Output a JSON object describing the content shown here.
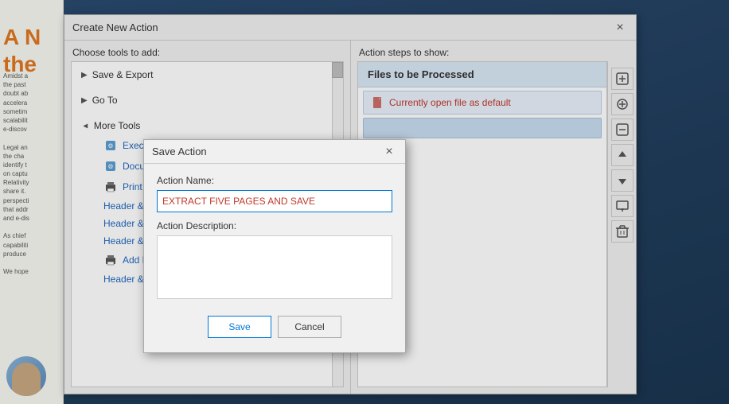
{
  "background": {
    "orange_title": "A N",
    "orange_title2": "the",
    "body_lines": [
      "Amidst a",
      "the past",
      "doubt ab",
      "accelera",
      "sometim",
      "scalabilit",
      "e-discov",
      "",
      "Legal an",
      "the cha",
      "identify t",
      "on captu",
      "Relativity",
      "share it.",
      "perspecti",
      "that addr",
      "and e-dis",
      "",
      "As chief",
      "capabiliti",
      "produce",
      "",
      "We hope"
    ]
  },
  "main_dialog": {
    "title": "Create New Action",
    "close_label": "×",
    "left_panel_label": "Choose tools to add:",
    "right_panel_label": "Action steps to show:",
    "tools": [
      {
        "id": "save-export",
        "label": "Save & Export",
        "type": "group",
        "arrow": "▶",
        "expanded": false
      },
      {
        "id": "go-to",
        "label": "Go To",
        "type": "group",
        "arrow": "▶",
        "expanded": false
      },
      {
        "id": "more-tools",
        "label": "More Tools",
        "type": "group",
        "arrow": "▼",
        "expanded": true
      }
    ],
    "more_tools_items": [
      {
        "id": "execute-js",
        "label": "Execute JavaScript",
        "icon": "⚙"
      },
      {
        "id": "document-js",
        "label": "DocumentJavaScripts",
        "icon": "⚙"
      },
      {
        "id": "print",
        "label": "Print",
        "icon": "🖨"
      },
      {
        "id": "header-footer-1",
        "label": "Header & Footer (Add..."
      },
      {
        "id": "header-footer-2",
        "label": "Header & Footer (Add..."
      },
      {
        "id": "header-footer-3",
        "label": "Header & Footer (Add..."
      },
      {
        "id": "add-printer-marks",
        "label": "Add Printer Marks",
        "icon": "🖨"
      },
      {
        "id": "header-footer-4",
        "label": "Header & Footer (Add)"
      }
    ],
    "action_steps_header": "Files to be Processed",
    "action_step_item": "Currently open file as default",
    "side_toolbar_buttons": [
      {
        "id": "add-btn",
        "icon": "⊕",
        "label": "add"
      },
      {
        "id": "settings-btn",
        "icon": "⊕",
        "label": "settings"
      },
      {
        "id": "minus-btn",
        "icon": "—",
        "label": "remove-from-list"
      },
      {
        "id": "up-btn",
        "icon": "↑",
        "label": "move-up"
      },
      {
        "id": "down-btn",
        "icon": "↓",
        "label": "move-down"
      },
      {
        "id": "screen-btn",
        "icon": "▣",
        "label": "screen"
      },
      {
        "id": "delete-btn",
        "icon": "🗑",
        "label": "delete"
      }
    ]
  },
  "save_dialog": {
    "title": "Save Action",
    "close_label": "×",
    "action_name_label": "Action Name:",
    "action_name_value": "EXTRACT FIVE PAGES AND SAVE",
    "action_description_label": "Action Description:",
    "action_description_value": "",
    "save_button_label": "Save",
    "cancel_button_label": "Cancel"
  }
}
